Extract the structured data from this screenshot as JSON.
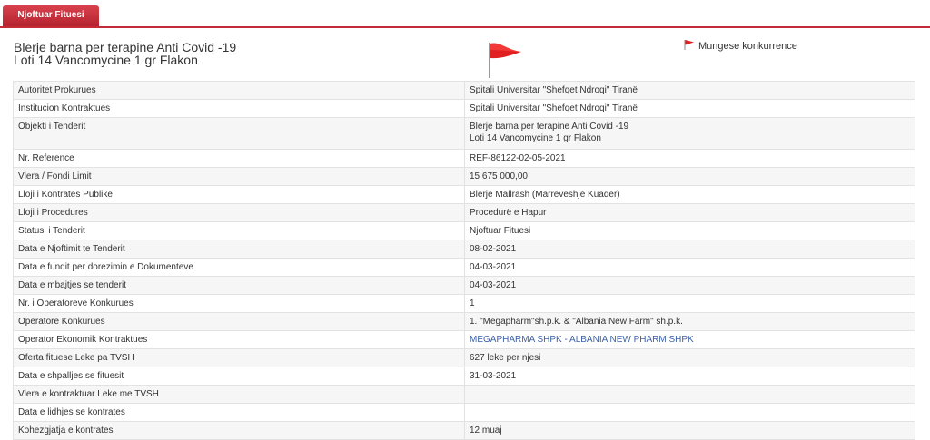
{
  "tab": {
    "label": "Njoftuar Fituesi"
  },
  "header": {
    "title_line1": "Blerje barna per terapine Anti Covid -19",
    "title_line2": "Loti 14 Vancomycine 1 gr Flakon",
    "flag_color": "#e02020",
    "competition_label": "Mungese konkurrence"
  },
  "rows": [
    {
      "label": "Autoritet Prokurues",
      "value": "Spitali Universitar \"Shefqet Ndroqi\" Tiranë"
    },
    {
      "label": "Institucion Kontraktues",
      "value": "Spitali Universitar \"Shefqet Ndroqi\" Tiranë"
    },
    {
      "label": "Objekti i Tenderit",
      "value_line1": "Blerje barna per terapine Anti Covid -19",
      "value_line2": "Loti 14 Vancomycine 1 gr Flakon"
    },
    {
      "label": "Nr. Reference",
      "value": "REF-86122-02-05-2021"
    },
    {
      "label": "Vlera / Fondi Limit",
      "value": "15 675 000,00"
    },
    {
      "label": "Lloji i Kontrates Publike",
      "value": "Blerje Mallrash (Marrëveshje Kuadër)"
    },
    {
      "label": "Lloji i Procedures",
      "value": "Procedurë e Hapur"
    },
    {
      "label": "Statusi i Tenderit",
      "value": "Njoftuar Fituesi"
    },
    {
      "label": "Data e Njoftimit te Tenderit",
      "value": "08-02-2021"
    },
    {
      "label": "Data e fundit per dorezimin e Dokumenteve",
      "value": "04-03-2021"
    },
    {
      "label": "Data e mbajtjes se tenderit",
      "value": "04-03-2021"
    },
    {
      "label": "Nr. i Operatoreve Konkurues",
      "value": "1"
    },
    {
      "label": "Operatore Konkurues",
      "value": "1. \"Megapharm\"sh.p.k. & \"Albania New Farm\" sh.p.k."
    },
    {
      "label": "Operator Ekonomik Kontraktues",
      "value": "MEGAPHARMA SHPK - ALBANIA NEW PHARM  SHPK"
    },
    {
      "label": "Oferta fituese Leke pa TVSH",
      "value": "627 leke per njesi"
    },
    {
      "label": "Data e shpalljes se fituesit",
      "value": "31-03-2021"
    },
    {
      "label": "Vlera e kontraktuar Leke me TVSH",
      "value": ""
    },
    {
      "label": "Data e lidhjes se kontrates",
      "value": ""
    },
    {
      "label": "Kohezgjatja e kontrates",
      "value": "12 muaj"
    }
  ]
}
